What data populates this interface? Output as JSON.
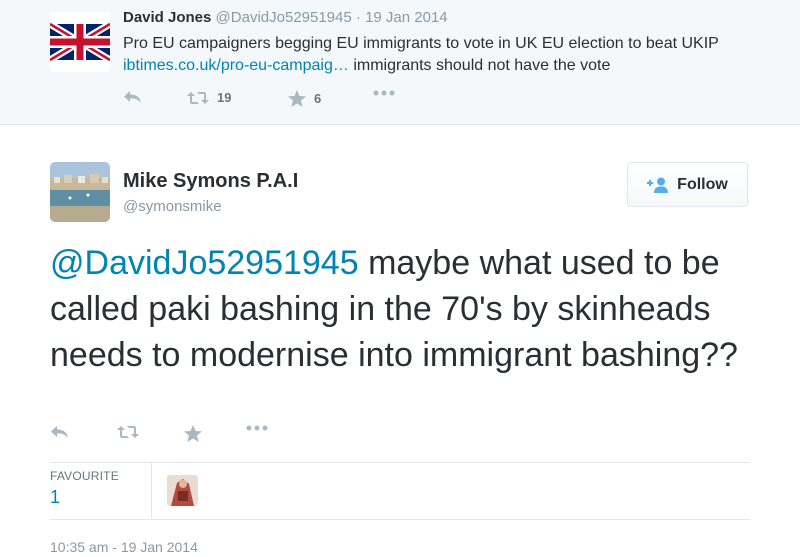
{
  "colors": {
    "link": "#0084b4",
    "text": "#292f33",
    "muted": "#8899a6",
    "icon": "#aab8c2"
  },
  "parent_tweet": {
    "author_name": "David Jones",
    "author_handle": "@DavidJo52951945",
    "separator": " · ",
    "date": "19 Jan 2014",
    "text_before_link": "Pro EU campaigners begging EU immigrants to vote in UK EU election to beat UKIP ",
    "link": "ibtimes.co.uk/pro-eu-campaig…",
    "text_after_link": " immigrants should not have the vote",
    "retweet_count": "19",
    "favorite_count": "6",
    "avatar_icon": "union-jack-flag"
  },
  "main_tweet": {
    "author_name": "Mike Symons P.A.I",
    "author_handle": "@symonsmike",
    "follow_label": "Follow",
    "mention": "@DavidJo52951945",
    "text": " maybe what used to be called paki bashing in the 70's by skinheads needs to modernise into immigrant bashing??",
    "favourite_label": "FAVOURITE",
    "favourite_count": "1",
    "timestamp": "10:35 am - 19 Jan 2014",
    "avatar_icon": "coastal-town-photo"
  },
  "icons": [
    "reply-icon",
    "retweet-icon",
    "favorite-star-icon",
    "more-icon",
    "follow-user-icon"
  ]
}
